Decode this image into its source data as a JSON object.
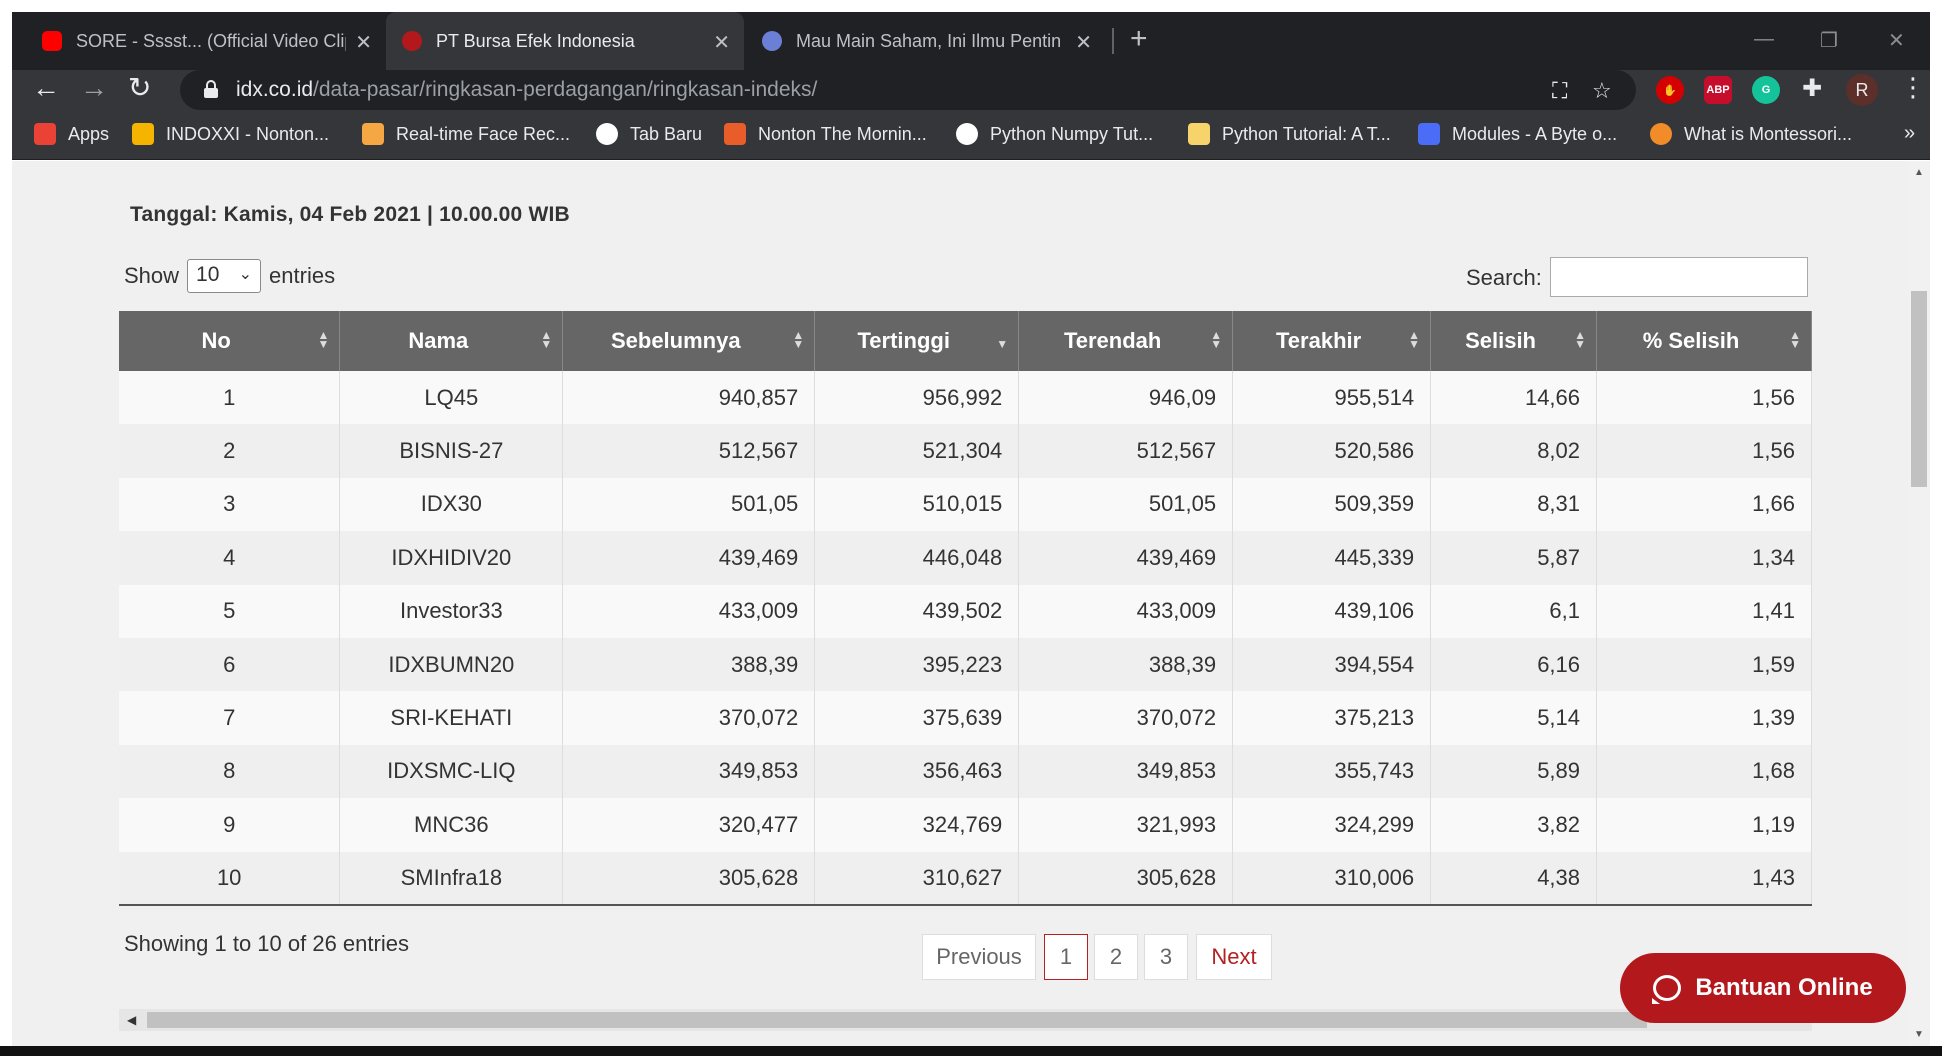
{
  "browser": {
    "tabs": [
      {
        "title": "SORE - Sssst... (Official Video Clip",
        "favicon_color": "#ff0000",
        "active": false
      },
      {
        "title": "PT Bursa Efek Indonesia",
        "favicon_color": "#b3181d",
        "active": true
      },
      {
        "title": "Mau Main Saham, Ini Ilmu Pentin",
        "favicon_color": "#6b7fd7",
        "active": false
      }
    ],
    "new_tab": "+",
    "url_host": "idx.co.id",
    "url_path": "/data-pasar/ringkasan-perdagangan/ringkasan-indeks/",
    "extensions": [
      {
        "name": "adblock-hand",
        "color": "#d50000",
        "label": "✋"
      },
      {
        "name": "abp",
        "color": "#c70d2c",
        "label": "ABP"
      },
      {
        "name": "grammarly",
        "color": "#15c39a",
        "label": "G"
      }
    ],
    "profile_initial": "R",
    "bookmarks": [
      {
        "label": "Apps",
        "color": "#ea4335"
      },
      {
        "label": "INDOXXI - Nonton...",
        "color": "#f4b400"
      },
      {
        "label": "Real-time Face Rec...",
        "color": "#f4a742"
      },
      {
        "label": "Tab Baru",
        "color": "#ffffff"
      },
      {
        "label": "Nonton The Mornin...",
        "color": "#e85d2a"
      },
      {
        "label": "Python Numpy Tut...",
        "color": "#ffffff"
      },
      {
        "label": "Python Tutorial: A T...",
        "color": "#f6d36b"
      },
      {
        "label": "Modules - A Byte o...",
        "color": "#4a6cf7"
      },
      {
        "label": "What is Montessori...",
        "color": "#f28c28"
      }
    ],
    "bookmarks_more": "»"
  },
  "page": {
    "date": "Tanggal: Kamis, 04 Feb 2021 | 10.00.00 WIB",
    "show_prefix": "Show",
    "show_value": "10",
    "show_suffix": "entries",
    "search_label": "Search:",
    "search_value": "",
    "columns": [
      "No",
      "Nama",
      "Sebelumnya",
      "Tertinggi",
      "Terendah",
      "Terakhir",
      "Selisih",
      "% Selisih"
    ],
    "rows": [
      [
        "1",
        "LQ45",
        "940,857",
        "956,992",
        "946,09",
        "955,514",
        "14,66",
        "1,56"
      ],
      [
        "2",
        "BISNIS-27",
        "512,567",
        "521,304",
        "512,567",
        "520,586",
        "8,02",
        "1,56"
      ],
      [
        "3",
        "IDX30",
        "501,05",
        "510,015",
        "501,05",
        "509,359",
        "8,31",
        "1,66"
      ],
      [
        "4",
        "IDXHIDIV20",
        "439,469",
        "446,048",
        "439,469",
        "445,339",
        "5,87",
        "1,34"
      ],
      [
        "5",
        "Investor33",
        "433,009",
        "439,502",
        "433,009",
        "439,106",
        "6,1",
        "1,41"
      ],
      [
        "6",
        "IDXBUMN20",
        "388,39",
        "395,223",
        "388,39",
        "394,554",
        "6,16",
        "1,59"
      ],
      [
        "7",
        "SRI-KEHATI",
        "370,072",
        "375,639",
        "370,072",
        "375,213",
        "5,14",
        "1,39"
      ],
      [
        "8",
        "IDXSMC-LIQ",
        "349,853",
        "356,463",
        "349,853",
        "355,743",
        "5,89",
        "1,68"
      ],
      [
        "9",
        "MNC36",
        "320,477",
        "324,769",
        "321,993",
        "324,299",
        "3,82",
        "1,19"
      ],
      [
        "10",
        "SMInfra18",
        "305,628",
        "310,627",
        "305,628",
        "310,006",
        "4,38",
        "1,43"
      ]
    ],
    "info": "Showing 1 to 10 of 26 entries",
    "pagination": {
      "previous": "Previous",
      "pages": [
        "1",
        "2",
        "3"
      ],
      "current": "1",
      "next": "Next"
    },
    "help_button": "Bantuan Online"
  }
}
